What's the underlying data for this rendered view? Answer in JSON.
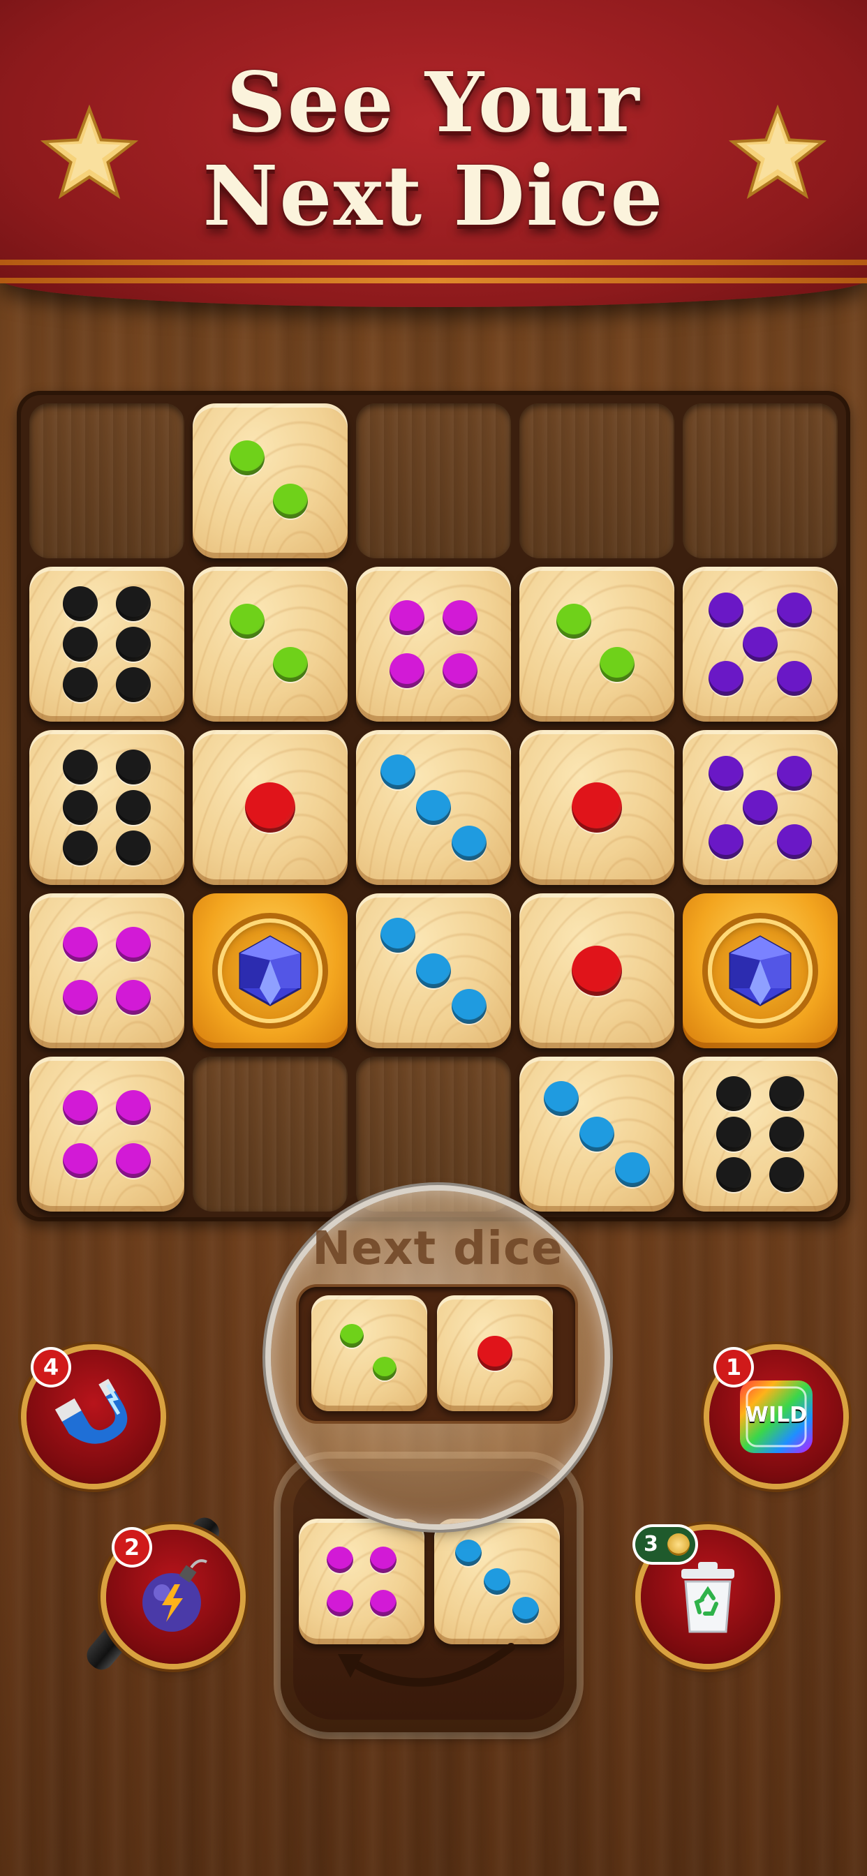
{
  "banner": {
    "title_line1": "See Your",
    "title_line2": "Next Dice"
  },
  "board": {
    "rows": 5,
    "cols": 5,
    "cells": [
      [
        {
          "type": "empty"
        },
        {
          "type": "die",
          "value": 2,
          "color": "#6fd11a"
        },
        {
          "type": "empty"
        },
        {
          "type": "empty"
        },
        {
          "type": "empty"
        }
      ],
      [
        {
          "type": "die",
          "value": 6,
          "color": "#1a1a1a"
        },
        {
          "type": "die",
          "value": 2,
          "color": "#6fd11a"
        },
        {
          "type": "die",
          "value": 4,
          "color": "#d21ad6"
        },
        {
          "type": "die",
          "value": 2,
          "color": "#6fd11a"
        },
        {
          "type": "die",
          "value": 5,
          "color": "#6a18c6"
        }
      ],
      [
        {
          "type": "die",
          "value": 6,
          "color": "#1a1a1a"
        },
        {
          "type": "die",
          "value": 1,
          "color": "#e0141a"
        },
        {
          "type": "die",
          "value": 3,
          "color": "#1f9be0"
        },
        {
          "type": "die",
          "value": 1,
          "color": "#e0141a"
        },
        {
          "type": "die",
          "value": 5,
          "color": "#6a18c6"
        }
      ],
      [
        {
          "type": "die",
          "value": 4,
          "color": "#d21ad6"
        },
        {
          "type": "gem"
        },
        {
          "type": "die",
          "value": 3,
          "color": "#1f9be0"
        },
        {
          "type": "die",
          "value": 1,
          "color": "#e0141a"
        },
        {
          "type": "gem"
        }
      ],
      [
        {
          "type": "die",
          "value": 4,
          "color": "#d21ad6"
        },
        {
          "type": "empty"
        },
        {
          "type": "empty"
        },
        {
          "type": "die",
          "value": 3,
          "color": "#1f9be0"
        },
        {
          "type": "die",
          "value": 6,
          "color": "#1a1a1a"
        }
      ]
    ]
  },
  "next_dice": {
    "label": "Next dice",
    "dice": [
      {
        "value": 2,
        "color": "#6fd11a"
      },
      {
        "value": 1,
        "color": "#e0141a"
      }
    ]
  },
  "current_dice": {
    "dice": [
      {
        "value": 4,
        "color": "#d21ad6"
      },
      {
        "value": 3,
        "color": "#1f9be0"
      }
    ]
  },
  "boosters": {
    "magnet": {
      "count": "4",
      "icon": "magnet-icon"
    },
    "bomb": {
      "count": "2",
      "icon": "bomb-icon"
    },
    "wild": {
      "count": "1",
      "label": "WILD",
      "icon": "wild-icon"
    },
    "trash": {
      "count": "3",
      "icon": "trash-icon"
    }
  }
}
